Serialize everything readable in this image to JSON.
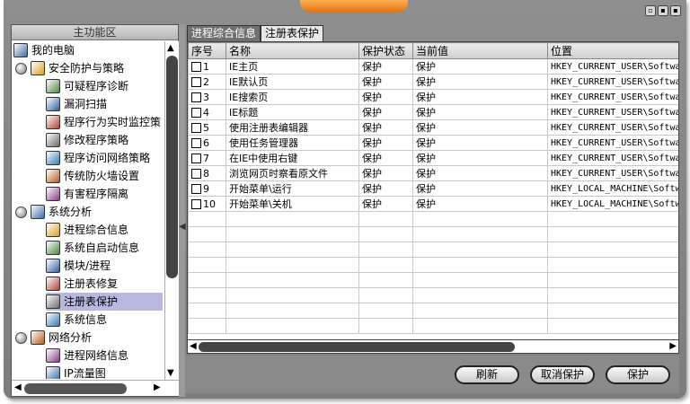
{
  "left_panel": {
    "header": "主功能区",
    "tree": [
      {
        "label": "我的电脑",
        "icon": "computer-icon",
        "level": 0,
        "expander": false
      },
      {
        "label": "安全防护与策略",
        "icon": "shield-policy-icon",
        "level": 1,
        "expander": true
      },
      {
        "label": "可疑程序诊断",
        "icon": "diagnose-icon",
        "level": 2
      },
      {
        "label": "漏洞扫描",
        "icon": "magnifier-icon",
        "level": 2
      },
      {
        "label": "程序行为实时监控策",
        "icon": "monitor-icon",
        "level": 2
      },
      {
        "label": "修改程序策略",
        "icon": "policy-edit-icon",
        "level": 2
      },
      {
        "label": "程序访问网络策略",
        "icon": "network-policy-icon",
        "level": 2
      },
      {
        "label": "传统防火墙设置",
        "icon": "firewall-icon",
        "level": 2
      },
      {
        "label": "有害程序隔离",
        "icon": "quarantine-icon",
        "level": 2
      },
      {
        "label": "系统分析",
        "icon": "system-analysis-icon",
        "level": 1,
        "expander": true
      },
      {
        "label": "进程综合信息",
        "icon": "process-icon",
        "level": 2
      },
      {
        "label": "系统自启动信息",
        "icon": "startup-icon",
        "level": 2
      },
      {
        "label": "模块/进程",
        "icon": "module-icon",
        "level": 2
      },
      {
        "label": "注册表修复",
        "icon": "registry-repair-icon",
        "level": 2
      },
      {
        "label": "注册表保护",
        "icon": "registry-protect-icon",
        "level": 2,
        "selected": true
      },
      {
        "label": "系统信息",
        "icon": "system-info-icon",
        "level": 2
      },
      {
        "label": "网络分析",
        "icon": "network-analysis-icon",
        "level": 1,
        "expander": true
      },
      {
        "label": "进程网络信息",
        "icon": "process-network-icon",
        "level": 2
      },
      {
        "label": "IP流量图",
        "icon": "traffic-chart-icon",
        "level": 2
      }
    ]
  },
  "tabs": [
    {
      "label": "进程综合信息",
      "active": false
    },
    {
      "label": "注册表保护",
      "active": true
    }
  ],
  "table": {
    "columns": [
      "序号",
      "名称",
      "保护状态",
      "当前值",
      "位置"
    ],
    "rows": [
      {
        "no": "1",
        "name": "IE主页",
        "status": "保护",
        "value": "保护",
        "location": "HKEY_CURRENT_USER\\Software"
      },
      {
        "no": "2",
        "name": "IE默认页",
        "status": "保护",
        "value": "保护",
        "location": "HKEY_CURRENT_USER\\Software"
      },
      {
        "no": "3",
        "name": "IE搜索页",
        "status": "保护",
        "value": "保护",
        "location": "HKEY_CURRENT_USER\\Software"
      },
      {
        "no": "4",
        "name": "IE标题",
        "status": "保护",
        "value": "保护",
        "location": "HKEY_CURRENT_USER\\Software"
      },
      {
        "no": "5",
        "name": "使用注册表编辑器",
        "status": "保护",
        "value": "保护",
        "location": "HKEY_CURRENT_USER\\Software"
      },
      {
        "no": "6",
        "name": "使用任务管理器",
        "status": "保护",
        "value": "保护",
        "location": "HKEY_CURRENT_USER\\Software"
      },
      {
        "no": "7",
        "name": "在IE中使用右键",
        "status": "保护",
        "value": "保护",
        "location": "HKEY_CURRENT_USER\\Software"
      },
      {
        "no": "8",
        "name": "浏览网页时察看原文件",
        "status": "保护",
        "value": "保护",
        "location": "HKEY_CURRENT_USER\\Software"
      },
      {
        "no": "9",
        "name": "开始菜单\\运行",
        "status": "保护",
        "value": "保护",
        "location": "HKEY_LOCAL_MACHINE\\Software"
      },
      {
        "no": "10",
        "name": "开始菜单\\关机",
        "status": "保护",
        "value": "保护",
        "location": "HKEY_LOCAL_MACHINE\\Software"
      }
    ],
    "empty_rows": 8
  },
  "buttons": {
    "refresh": "刷新",
    "unprotect": "取消保护",
    "protect": "保护"
  }
}
